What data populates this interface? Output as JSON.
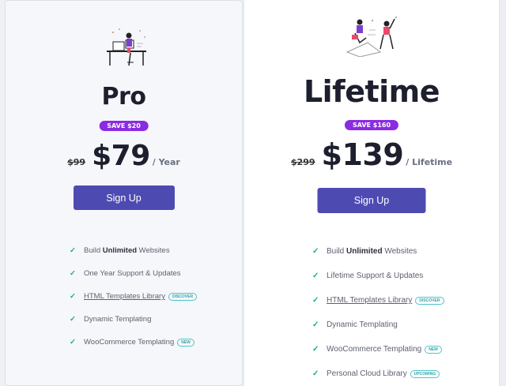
{
  "plans": [
    {
      "name": "Pro",
      "save_badge": "SAVE $20",
      "old_price": "$99",
      "price": "$79",
      "period": "/ Year",
      "cta": "Sign Up",
      "features": [
        {
          "pre": "Build ",
          "bold": "Unlimited",
          "post": " Websites"
        },
        {
          "text": "One Year Support & Updates"
        },
        {
          "link": "HTML Templates Library",
          "tag": "DISCOVER"
        },
        {
          "text": "Dynamic Templating"
        },
        {
          "text": "WooCommerce Templating",
          "tag": "NEW"
        }
      ]
    },
    {
      "name": "Lifetime",
      "save_badge": "SAVE $160",
      "old_price": "$299",
      "price": "$139",
      "period": "/ Lifetime",
      "cta": "Sign Up",
      "features": [
        {
          "pre": "Build ",
          "bold": "Unlimited",
          "post": " Websites"
        },
        {
          "text": "Lifetime Support & Updates"
        },
        {
          "link": "HTML Templates Library",
          "tag": "DISCOVER"
        },
        {
          "text": "Dynamic Templating"
        },
        {
          "text": "WooCommerce Templating",
          "tag": "NEW"
        },
        {
          "text": "Personal Cloud Library",
          "tag": "UPCOMING"
        }
      ]
    }
  ],
  "colors": {
    "accent": "#4d4bb2",
    "badge": "#8a2be2",
    "check": "#1aaf7d",
    "tag": "#2fa4aa"
  },
  "icons": {
    "pro_illustration": "person-at-desk-illustration",
    "lifetime_illustration": "people-collaborating-illustration",
    "feature_bullet": "check-icon"
  }
}
